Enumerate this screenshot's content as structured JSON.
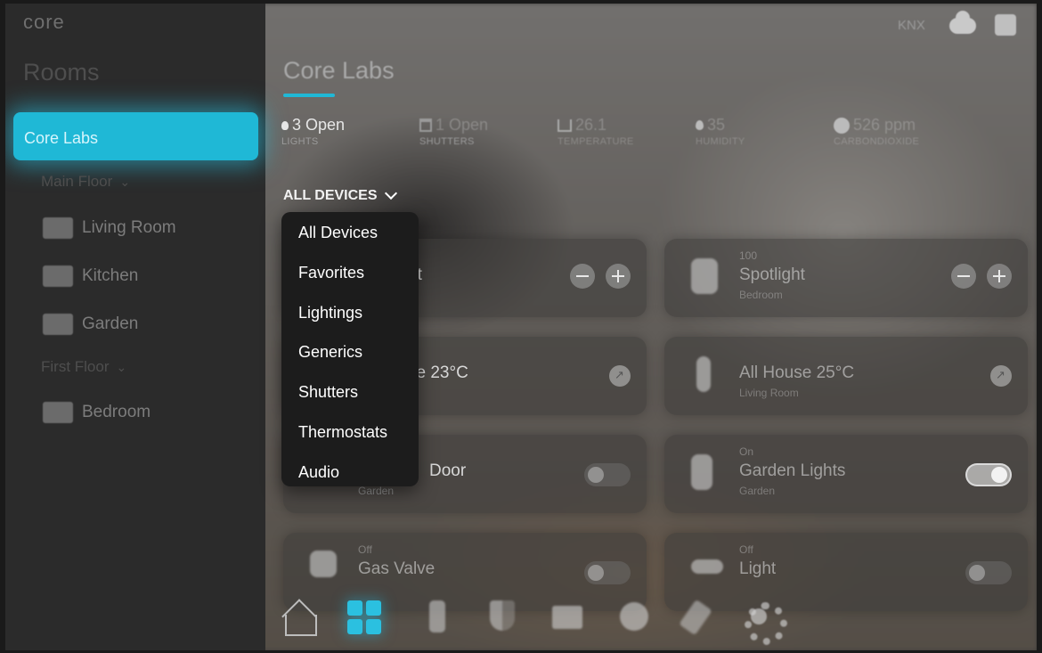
{
  "app": {
    "logo": "core"
  },
  "top_right": {
    "protocol": "KNX",
    "cloud_icon": "cloud-icon",
    "home_icon": "home-box-icon"
  },
  "sidebar": {
    "title": "Rooms",
    "active_room": "Core Labs",
    "floors": [
      {
        "label": "Main Floor",
        "rooms": [
          "Living Room",
          "Kitchen",
          "Garden"
        ]
      },
      {
        "label": "First Floor",
        "rooms": [
          "Bedroom"
        ]
      }
    ]
  },
  "main": {
    "title": "Core Labs",
    "stats": [
      {
        "value": "3 Open",
        "caption": "LIGHTS",
        "icon": "bulb-icon"
      },
      {
        "value": "1 Open",
        "caption": "SHUTTERS",
        "icon": "shutter-icon"
      },
      {
        "value": "26.1",
        "caption": "TEMPERATURE",
        "icon": "house-temp-icon"
      },
      {
        "value": "35",
        "caption": "HUMIDITY",
        "icon": "drop-icon"
      },
      {
        "value": "526 ppm",
        "caption": "CARBONDIOXIDE",
        "icon": "co2-icon"
      }
    ],
    "filter_label": "ALL DEVICES",
    "dropdown_options": [
      "All Devices",
      "Favorites",
      "Lightings",
      "Generics",
      "Shutters",
      "Thermostats",
      "Audio"
    ],
    "cards": {
      "c1": {
        "status": "",
        "name": "nt",
        "room": "m"
      },
      "c2": {
        "status": "100",
        "name": "Spotlight",
        "room": "Bedroom"
      },
      "c3": {
        "status": "",
        "name": "se 23°C",
        "room": "m"
      },
      "c4": {
        "status": "",
        "name": "All House 25°C",
        "room": "Living Room"
      },
      "c5": {
        "status": "",
        "name": "Door",
        "room": "Garden"
      },
      "c6": {
        "status": "On",
        "name": "Garden Lights",
        "room": "Garden"
      },
      "c7": {
        "status": "Off",
        "name": "Gas Valve",
        "room": ""
      },
      "c8": {
        "status": "Off",
        "name": "Light",
        "room": ""
      }
    }
  },
  "accent_color": "#20b8d6"
}
